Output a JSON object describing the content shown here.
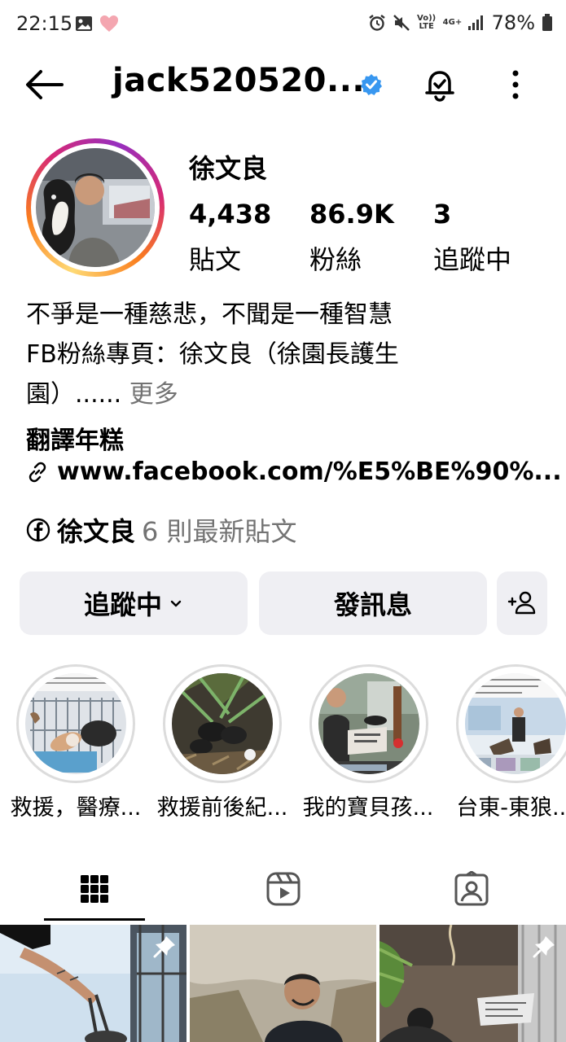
{
  "status_bar": {
    "time": "22:15",
    "battery": "78%",
    "volte": "Vo)) LTE",
    "network": "4G+"
  },
  "header": {
    "username": "jack520520...",
    "verified": true,
    "icons": [
      "back-arrow-icon",
      "verified-badge-icon",
      "notification-bell-icon",
      "more-vertical-icon"
    ]
  },
  "profile": {
    "display_name": "徐文良",
    "stats": [
      {
        "value": "4,438",
        "label": "貼文"
      },
      {
        "value": "86.9K",
        "label": "粉絲"
      },
      {
        "value": "3",
        "label": "追蹤中"
      }
    ],
    "bio_lines": [
      "不爭是一種慈悲，不聞是一種智慧",
      "FB粉絲專頁：徐文良（徐園長護生",
      "園）......"
    ],
    "more": "更多",
    "category": "翻譯年糕",
    "link": "www.facebook.com/%E5%BE%90%...",
    "fb": {
      "name": "徐文良",
      "posts": "6 則最新貼文"
    }
  },
  "actions": {
    "following": "追蹤中",
    "message": "發訊息"
  },
  "highlights": [
    {
      "label": "救援，醫療..."
    },
    {
      "label": "救援前後紀..."
    },
    {
      "label": "我的寶貝孩..."
    },
    {
      "label": "台東-東狼..."
    }
  ],
  "tabs": [
    "grid-icon",
    "reels-icon",
    "tagged-icon"
  ],
  "colors": {
    "verified": "#3897f0",
    "button_bg": "#efeff3",
    "secondary_text": "#737373"
  }
}
